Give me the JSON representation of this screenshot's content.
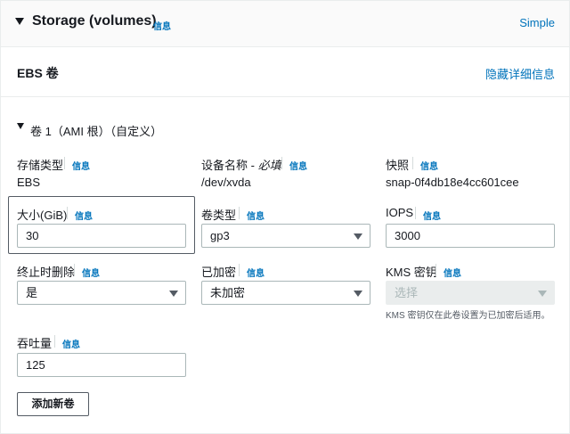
{
  "header": {
    "title": "Storage (volumes)",
    "info": "信息",
    "simple_link": "Simple"
  },
  "ebs": {
    "title": "EBS 卷",
    "hide_details_link": "隐藏详细信息"
  },
  "volume": {
    "title": "卷 1（AMI 根）（自定义）",
    "info": "信息",
    "storage_type": {
      "label": "存储类型",
      "value": "EBS"
    },
    "device_name": {
      "label": "设备名称 - ",
      "required": "必填",
      "value": "/dev/xvda"
    },
    "snapshot": {
      "label": "快照",
      "value": "snap-0f4db18e4cc601cee"
    },
    "size": {
      "label": "大小(GiB)",
      "value": "30"
    },
    "volume_type": {
      "label": "卷类型",
      "value": "gp3"
    },
    "iops": {
      "label": "IOPS",
      "value": "3000"
    },
    "delete_on_termination": {
      "label": "终止时删除",
      "value": "是"
    },
    "encrypted": {
      "label": "已加密",
      "value": "未加密"
    },
    "kms_key": {
      "label": "KMS 密钥",
      "placeholder": "选择",
      "hint": "KMS 密钥仅在此卷设置为已加密后适用。"
    },
    "throughput": {
      "label": "吞吐量",
      "value": "125"
    }
  },
  "add_volume_button": "添加新卷"
}
